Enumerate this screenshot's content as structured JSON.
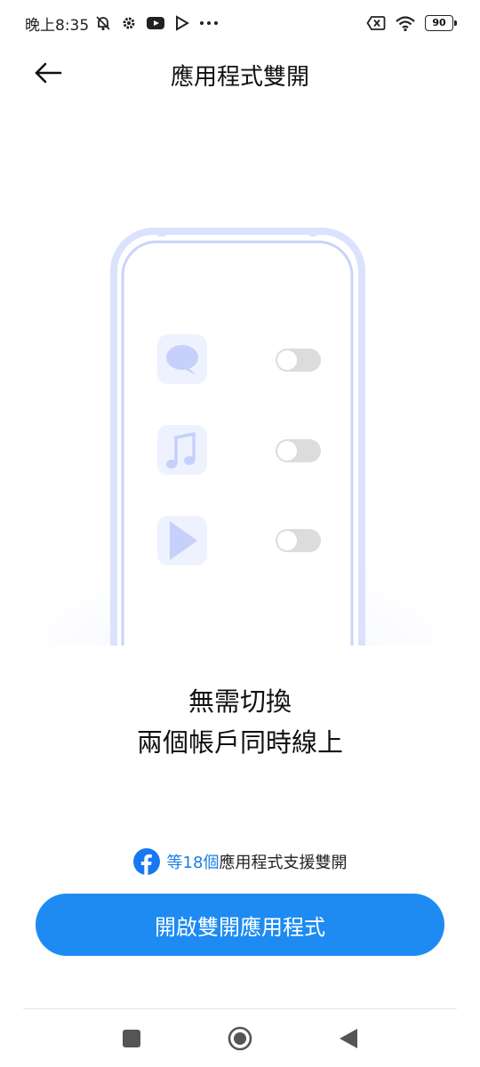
{
  "status_bar": {
    "time": "晚上8:35",
    "battery": "90"
  },
  "header": {
    "title": "應用程式雙開"
  },
  "headline": {
    "line1": "無需切換",
    "line2": "兩個帳戶同時線上"
  },
  "support": {
    "count_text": "等18個",
    "rest_text": "應用程式支援雙開"
  },
  "primary_button": {
    "label": "開啟雙開應用程式"
  },
  "colors": {
    "accent": "#1d8bf1",
    "link": "#1a7ee8",
    "facebook": "#1877f2",
    "phone_outline": "#c9d3fb",
    "app_icon_bg": "#eef2fe",
    "app_icon_fg": "#c5d0fb",
    "toggle_track": "#dcdcdc"
  },
  "icons": {
    "back": "arrow-left-icon",
    "app1": "chat-bubble-icon",
    "app2": "music-note-icon",
    "app3": "play-icon"
  }
}
